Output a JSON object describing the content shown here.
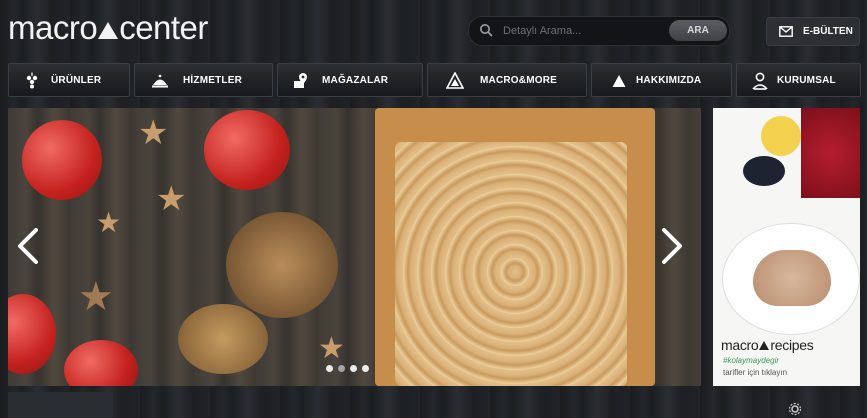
{
  "brand": {
    "logo_left": "macro",
    "logo_right": "center"
  },
  "search": {
    "placeholder": "Detaylı Arama...",
    "button_label": "ARA"
  },
  "newsletter": {
    "label": "E-BÜLTEN"
  },
  "nav": {
    "items": [
      {
        "label": "ÜRÜNLER",
        "icon": "grapes-icon"
      },
      {
        "label": "HİZMETLER",
        "icon": "cloche-icon"
      },
      {
        "label": "MAĞAZALAR",
        "icon": "store-location-icon"
      },
      {
        "label": "MACRO&MORE",
        "icon": "triangle-logo-icon"
      },
      {
        "label": "HAKKIMIZDA",
        "icon": "triangle-icon"
      },
      {
        "label": "KURUMSAL",
        "icon": "person-icon"
      }
    ]
  },
  "slider": {
    "prev_icon": "chevron-left-icon",
    "next_icon": "chevron-right-icon",
    "dot_count": 4,
    "active_dot": 1
  },
  "side_ad": {
    "brand_left": "macro",
    "brand_right": "recipes",
    "hashtag": "#kolaymaydegir",
    "subtitle": "tarifler için tıklayın"
  },
  "colors": {
    "page_background": "#1f2226",
    "nav_background": "#24272b",
    "text_primary": "#ffffff"
  }
}
